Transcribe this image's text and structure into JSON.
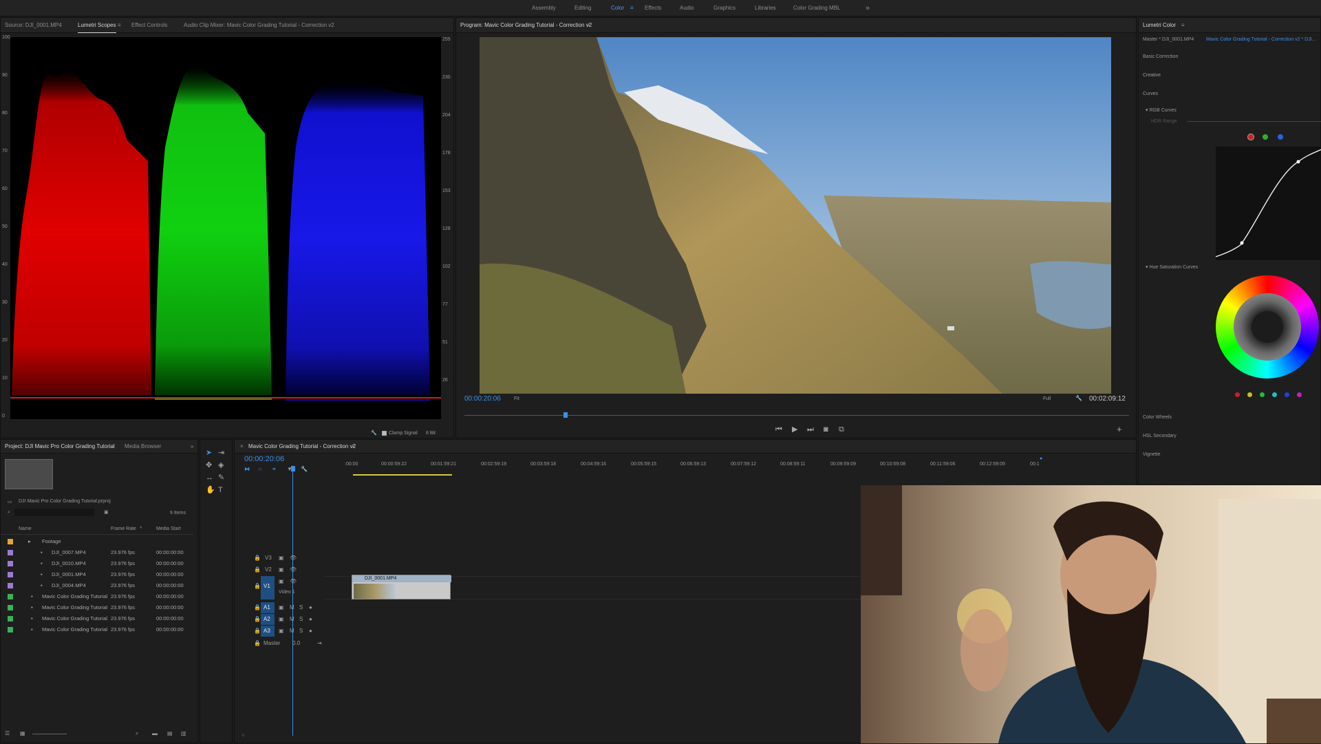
{
  "workspaces": [
    "Assembly",
    "Editing",
    "Color",
    "Effects",
    "Audio",
    "Graphics",
    "Libraries",
    "Color Grading MBL"
  ],
  "active_workspace": "Color",
  "workspace_overflow": "»",
  "source_panel": {
    "tabs": [
      "Source: DJI_0001.MP4",
      "Lumetri Scopes",
      "Effect Controls",
      "Audio Clip Mixer: Mavic Color Grading Tutorial - Correction v2"
    ],
    "active_tab": "Lumetri Scopes",
    "scale_left": [
      "100",
      "90",
      "80",
      "70",
      "60",
      "50",
      "40",
      "30",
      "20",
      "10",
      "0"
    ],
    "scale_right": [
      "255",
      "230",
      "204",
      "178",
      "153",
      "128",
      "102",
      "77",
      "51",
      "26"
    ],
    "clamp_signal": "Clamp Signal",
    "bit_depth": "8 Bit"
  },
  "program_panel": {
    "title": "Program: Mavic Color Grading Tutorial - Correction v2",
    "timecode": "00:00:20:06",
    "fit": "Fit",
    "quality": "Full",
    "duration": "00:02:09:12"
  },
  "lumetri": {
    "title": "Lumetri Color",
    "master": "Master * DJI_0001.MP4",
    "sequence": "Mavic Color Grading Tutorial - Correction v2 * DJI...",
    "sections": [
      "Basic Correction",
      "Creative",
      "Curves"
    ],
    "rgb_curves": "RGB Curves",
    "hdr_range": "HDR Range",
    "hue_saturation": "Hue Saturation Curves",
    "lower_sections": [
      "Color Wheels",
      "HSL Secondary",
      "Vignette"
    ],
    "curve_colors": [
      "#ffffff",
      "#d42020",
      "#2fb02f",
      "#2f5fe0"
    ]
  },
  "project_panel": {
    "tabs": [
      "Project: DJI Mavic Pro Color Grading Tutorial",
      "Media Browser"
    ],
    "project_file": "DJI Mavic Pro Color Grading Tutorial.prproj",
    "item_count": "9 Items",
    "columns": [
      "Name",
      "Frame Rate",
      "Media Start"
    ],
    "rows": [
      {
        "name": "Footage",
        "rate": "",
        "start": "",
        "color": "#e0a830",
        "folder": true
      },
      {
        "name": "DJI_0007.MP4",
        "rate": "23.976 fps",
        "start": "00:00:00:00",
        "color": "#9b7bd4"
      },
      {
        "name": "DJI_0010.MP4",
        "rate": "23.976 fps",
        "start": "00:00:00:00",
        "color": "#9b7bd4"
      },
      {
        "name": "DJI_0001.MP4",
        "rate": "23.976 fps",
        "start": "00:00:00:00",
        "color": "#9b7bd4"
      },
      {
        "name": "DJI_0004.MP4",
        "rate": "23.976 fps",
        "start": "00:00:00:00",
        "color": "#9b7bd4"
      },
      {
        "name": "Mavic Color Grading Tutorial",
        "rate": "23.976 fps",
        "start": "00:00:00:00",
        "color": "#3cb05a"
      },
      {
        "name": "Mavic Color Grading Tutorial",
        "rate": "23.976 fps",
        "start": "00:00:00:00",
        "color": "#3cb05a"
      },
      {
        "name": "Mavic Color Grading Tutorial",
        "rate": "23.976 fps",
        "start": "00:00:00:00",
        "color": "#3cb05a"
      },
      {
        "name": "Mavic Color Grading Tutorial",
        "rate": "23.976 fps",
        "start": "00:00:00:00",
        "color": "#3cb05a"
      }
    ]
  },
  "timeline": {
    "title": "Mavic Color Grading Tutorial - Correction v2",
    "timecode": "00:00:20:06",
    "ruler": [
      ":00:00",
      "00:00:59:22",
      "00:01:59:21",
      "00:02:59:19",
      "00:03:59:18",
      "00:04:59:16",
      "00:05:59:15",
      "00:06:59:13",
      "00:07:59:12",
      "00:08:59:11",
      "00:09:59:09",
      "00:10:59:08",
      "00:11:59:06",
      "00:12:59:05",
      "00:1"
    ],
    "video_tracks": [
      "V3",
      "V2",
      "V1"
    ],
    "video1_label": "Video 1",
    "audio_tracks": [
      "A1",
      "A2",
      "A3"
    ],
    "master": "Master",
    "master_value": "0.0",
    "clip_name": "DJI_0001.MP4"
  }
}
